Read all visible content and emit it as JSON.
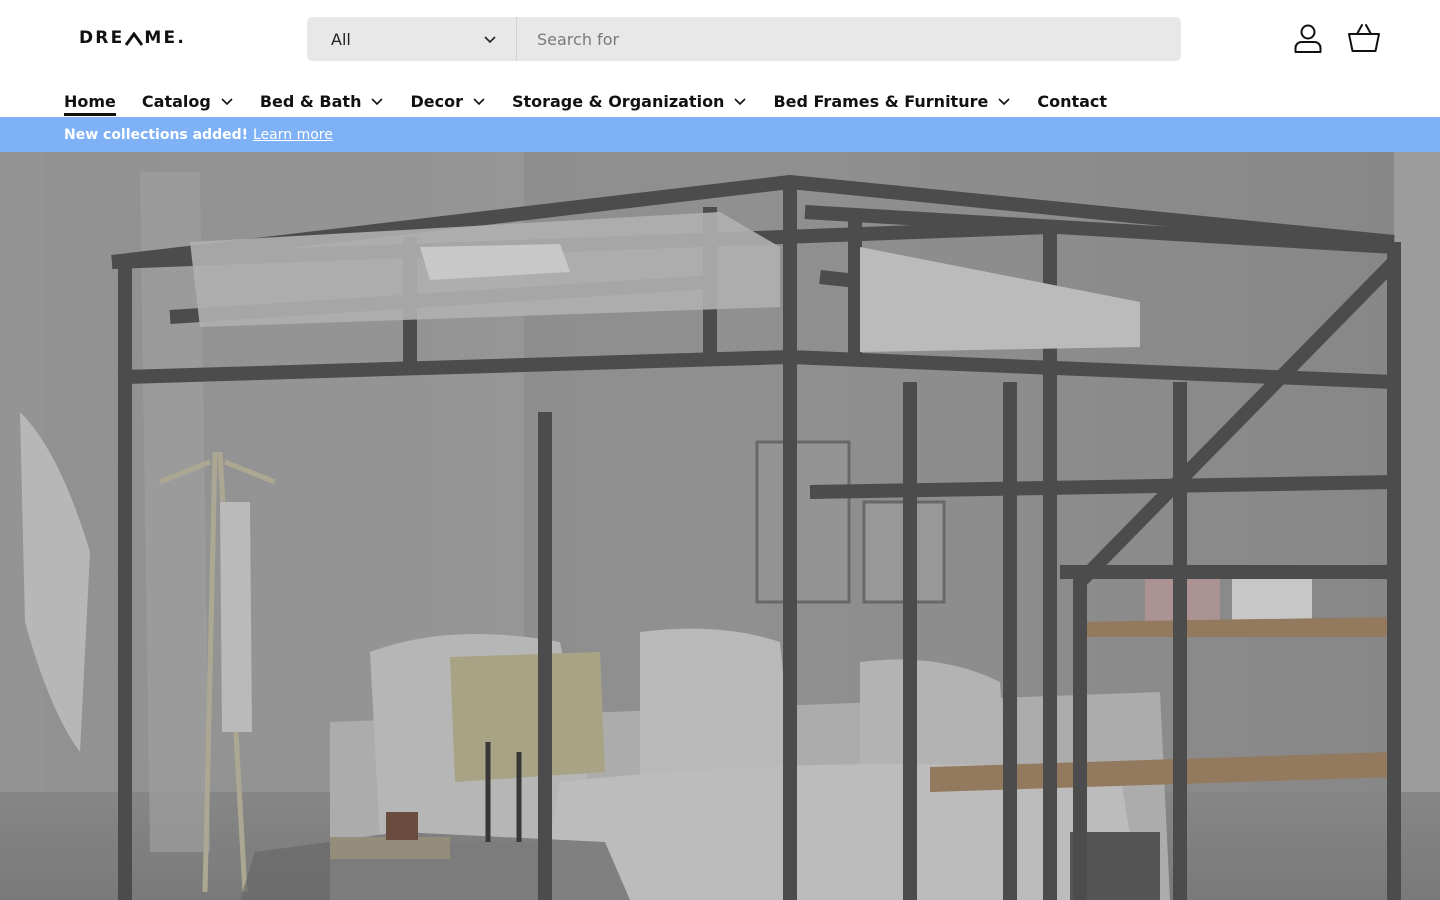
{
  "brand": {
    "logo_text_left": "DRE",
    "logo_text_right": "ME."
  },
  "search": {
    "category_selected": "All",
    "placeholder": "Search for"
  },
  "header_icons": [
    "account-icon",
    "basket-icon"
  ],
  "nav": {
    "items": [
      {
        "label": "Home",
        "active": true,
        "has_dropdown": false
      },
      {
        "label": "Catalog",
        "active": false,
        "has_dropdown": true
      },
      {
        "label": "Bed & Bath",
        "active": false,
        "has_dropdown": true
      },
      {
        "label": "Decor",
        "active": false,
        "has_dropdown": true
      },
      {
        "label": "Storage & Organization",
        "active": false,
        "has_dropdown": true
      },
      {
        "label": "Bed Frames & Furniture",
        "active": false,
        "has_dropdown": true
      },
      {
        "label": "Contact",
        "active": false,
        "has_dropdown": false
      }
    ]
  },
  "announcement": {
    "message": "New collections added!",
    "link": "Learn more",
    "background": "#7fb1f6"
  }
}
